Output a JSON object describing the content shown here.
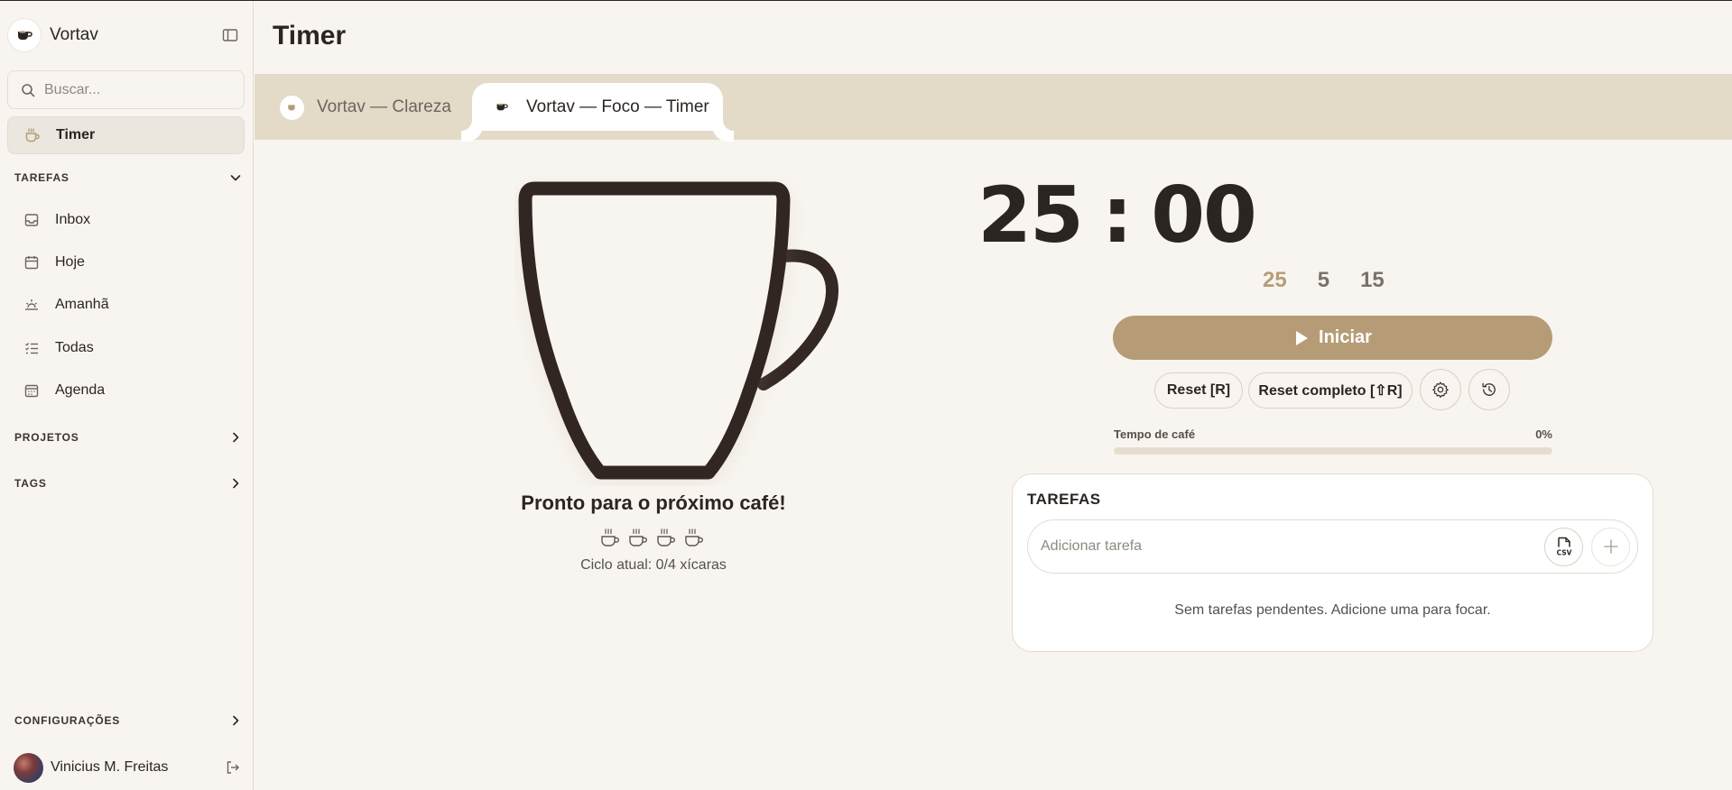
{
  "app": {
    "name": "Vortav"
  },
  "sidebar": {
    "search_placeholder": "Buscar...",
    "active_item": {
      "label": "Timer",
      "icon": "coffee-cup-icon"
    },
    "sections": {
      "tasks": {
        "title": "TAREFAS",
        "expanded": true
      },
      "projects": {
        "title": "PROJETOS",
        "expanded": false
      },
      "tags": {
        "title": "TAGS",
        "expanded": false
      },
      "settings": {
        "title": "CONFIGURAÇÕES",
        "expanded": false
      }
    },
    "items": [
      {
        "label": "Inbox",
        "icon": "inbox-icon"
      },
      {
        "label": "Hoje",
        "icon": "calendar-icon"
      },
      {
        "label": "Amanhã",
        "icon": "sunrise-icon"
      },
      {
        "label": "Todas",
        "icon": "list-check-icon"
      },
      {
        "label": "Agenda",
        "icon": "calendar-grid-icon"
      }
    ],
    "user": {
      "name": "Vinicius M. Freitas"
    }
  },
  "page": {
    "title": "Timer"
  },
  "tabs": [
    {
      "label": "Vortav — Clareza",
      "active": false
    },
    {
      "label": "Vortav — Foco — Timer",
      "active": true
    }
  ],
  "timer": {
    "minutes": "25",
    "separator": ":",
    "seconds": "00",
    "presets": [
      "25",
      "5",
      "15"
    ],
    "selected_preset": "25",
    "start_label": "Iniciar",
    "reset_label": "Reset [R]",
    "full_reset_label": "Reset completo [⇧R]",
    "progress": {
      "label": "Tempo de café",
      "value_text": "0%",
      "value": 0
    }
  },
  "cup_panel": {
    "status_message": "Pronto para o próximo café!",
    "cycle_text": "Ciclo atual: 0/4 xícaras",
    "cups_done": 0,
    "cups_total": 4
  },
  "tasks": {
    "title": "TAREFAS",
    "input_placeholder": "Adicionar tarefa",
    "csv_icon": "csv-file-icon",
    "empty_message": "Sem tarefas pendentes. Adicione uma para focar."
  },
  "colors": {
    "background": "#f8f5f0",
    "accent": "#b69c76",
    "tabbar": "#e4dac8",
    "ink": "#2b2521"
  }
}
